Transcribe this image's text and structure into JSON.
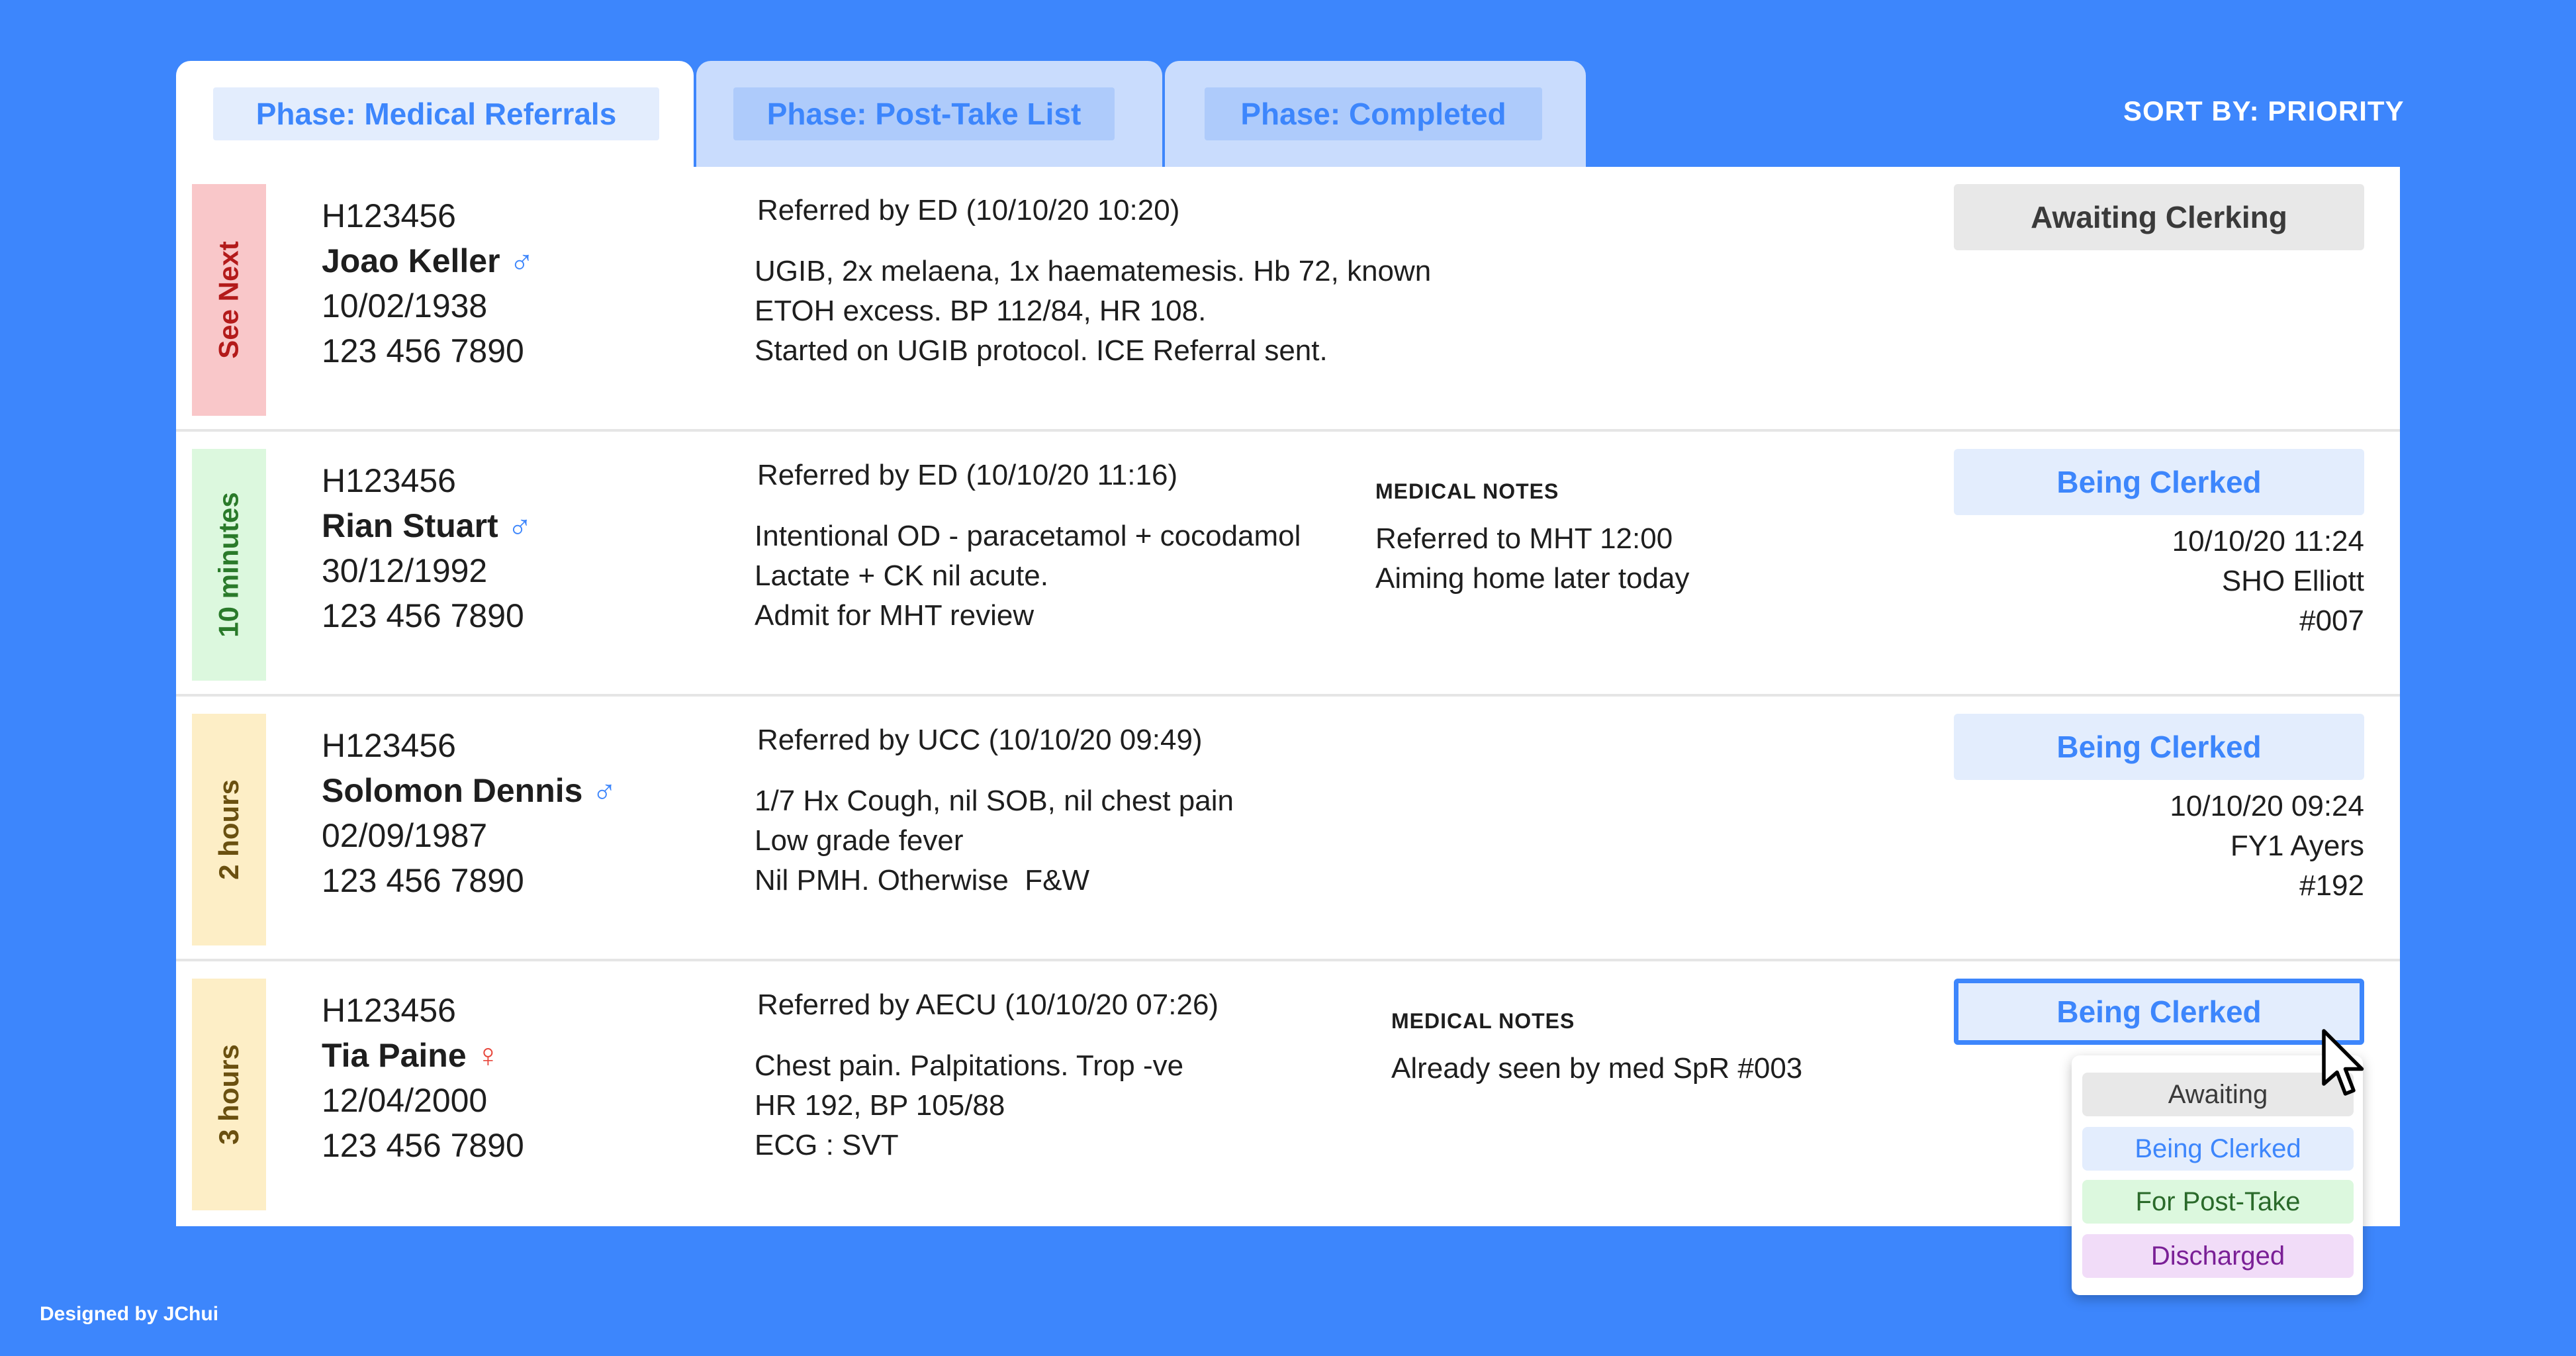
{
  "tabs": [
    {
      "label": "Phase: Medical Referrals",
      "active": true
    },
    {
      "label": "Phase: Post-Take List",
      "active": false
    },
    {
      "label": "Phase: Completed",
      "active": false
    }
  ],
  "sort_label": "SORT BY: PRIORITY",
  "patients": [
    {
      "priority": "See Next",
      "hospital_id": "H123456",
      "name": "Joao Keller",
      "sex_symbol": "♂",
      "dob": "10/02/1938",
      "phone": "123 456 7890",
      "referral": "Referred by ED (10/10/20 10:20)",
      "summary": [
        "UGIB, 2x melaena, 1x haematemesis. Hb 72, known",
        "ETOH excess. BP 112/84, HR 108.",
        "Started on UGIB protocol. ICE Referral sent."
      ],
      "status": "Awaiting Clerking"
    },
    {
      "priority": "10 minutes",
      "hospital_id": "H123456",
      "name": "Rian Stuart",
      "sex_symbol": "♂",
      "dob": "30/12/1992",
      "phone": "123 456 7890",
      "referral": "Referred by ED (10/10/20 11:16)",
      "summary": [
        "Intentional OD - paracetamol + cocodamol",
        "Lactate + CK nil acute.",
        "Admit for MHT review"
      ],
      "notes_heading": "MEDICAL NOTES",
      "notes": [
        "Referred to MHT 12:00",
        "Aiming home later today"
      ],
      "status": "Being Clerked",
      "clerk_time": "10/10/20 11:24",
      "clerk_name": "SHO Elliott",
      "clerk_id": "#007"
    },
    {
      "priority": "2 hours",
      "hospital_id": "H123456",
      "name": "Solomon Dennis",
      "sex_symbol": "♂",
      "dob": "02/09/1987",
      "phone": "123 456 7890",
      "referral": "Referred by UCC (10/10/20 09:49)",
      "summary": [
        "1/7 Hx Cough, nil SOB, nil chest pain",
        "Low grade fever",
        "Nil PMH. Otherwise  F&W"
      ],
      "status": "Being Clerked",
      "clerk_time": "10/10/20 09:24",
      "clerk_name": "FY1 Ayers",
      "clerk_id": "#192"
    },
    {
      "priority": "3 hours",
      "hospital_id": "H123456",
      "name": "Tia Paine",
      "sex_symbol": "♀",
      "dob": "12/04/2000",
      "phone": "123 456 7890",
      "referral": "Referred by AECU (10/10/20 07:26)",
      "summary": [
        "Chest pain. Palpitations. Trop -ve",
        "HR 192, BP 105/88",
        "ECG : SVT"
      ],
      "notes_heading": "MEDICAL NOTES",
      "notes": [
        "Already seen by med SpR #003"
      ],
      "status": "Being Clerked"
    }
  ],
  "status_dropdown": {
    "options": [
      "Awaiting",
      "Being Clerked",
      "For Post-Take",
      "Discharged"
    ]
  },
  "credit": "Designed by JChui",
  "colors": {
    "background": "#3d86fc",
    "accent": "#3d86fc",
    "priority_red": "#f9c7c9",
    "priority_green": "#dcf8de",
    "priority_yellow": "#fdeec6"
  }
}
